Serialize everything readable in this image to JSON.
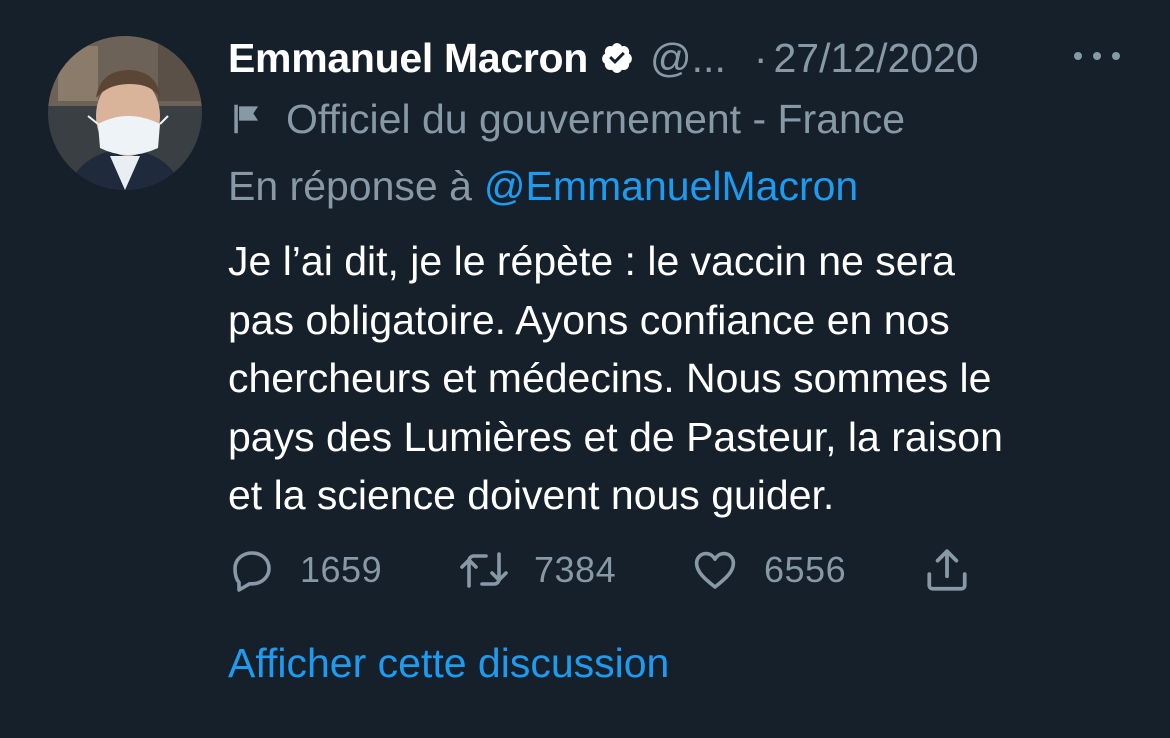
{
  "tweet": {
    "author": {
      "display_name": "Emmanuel Macron",
      "handle": "@...",
      "verified": true,
      "label": "Officiel du gouvernement - France"
    },
    "separator": "·",
    "date": "27/12/2020",
    "reply_to": {
      "prefix": "En réponse à",
      "handle": "@EmmanuelMacron"
    },
    "text_lines": [
      "Je l’ai dit, je le répète : le vaccin ne sera",
      "pas obligatoire. Ayons confiance en nos",
      "chercheurs et médecins. Nous sommes le",
      "pays des Lumières et de Pasteur, la raison",
      "et la science doivent nous guider."
    ],
    "actions": {
      "replies": "1659",
      "retweets": "7384",
      "likes": "6556"
    },
    "show_thread": "Afficher cette discussion"
  },
  "icons": {
    "verified": "verified-badge-icon",
    "more": "more-options-icon",
    "label": "flag-icon",
    "reply": "reply-icon",
    "retweet": "retweet-icon",
    "like": "heart-icon",
    "share": "share-icon"
  },
  "colors": {
    "background": "#15202b",
    "secondary_text": "#8899a6",
    "link": "#1d9bf0",
    "primary_text": "#ffffff"
  }
}
